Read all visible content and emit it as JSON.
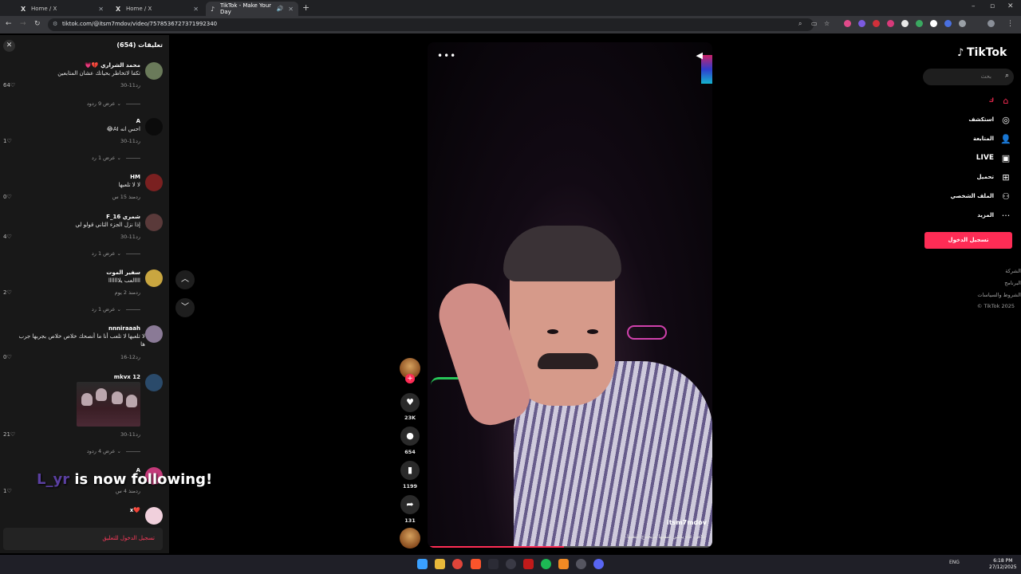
{
  "browser": {
    "tabs": [
      {
        "label": "Home / X",
        "favicon": "X"
      },
      {
        "label": "Home / X",
        "favicon": "X"
      },
      {
        "label": "TikTok - Make Your Day",
        "favicon": "♪"
      }
    ],
    "url": "tiktok.com/@itsm7mdov/video/7578536727371992340"
  },
  "comments_panel": {
    "title": "تعليقات (654)",
    "items": [
      {
        "name": "محمد الشراري 💔💗",
        "text": "تكفا لاتخاطر بحياتك عشان المتابعين",
        "date": "11-30",
        "reply": "رد",
        "likes": "64",
        "replies": "عرض 9 ردود",
        "avatar_color": "#6a7a5a"
      },
      {
        "name": "A",
        "text": "احس انه AI😂",
        "date": "11-30",
        "reply": "رد",
        "likes": "1",
        "replies": "عرض 1 رد",
        "avatar_color": "#0b0b0b"
      },
      {
        "name": "HM",
        "text": "لا لا تلعبها",
        "date": "منذ 15 س",
        "reply": "رد",
        "likes": "0",
        "replies": "",
        "avatar_color": "#7a2020"
      },
      {
        "name": "شمري F_16",
        "text": "إذا نزل الجزء الثاني قولو لي",
        "date": "11-30",
        "reply": "رد",
        "likes": "4",
        "replies": "عرض 1 رد",
        "avatar_color": "#5a3a3a"
      },
      {
        "name": "سفير الموت",
        "text": "اااالعب يلااااااا",
        "date": "منذ 2 يوم",
        "reply": "رد",
        "likes": "2",
        "replies": "عرض 1 رد",
        "avatar_color": "#c9a640"
      },
      {
        "name": "nnniraaah",
        "text": "لا تلعبها لا تلعب أنا ما أنصحك خلاص خلاص بجربها جرب",
        "text2": "ها",
        "date": "12-16",
        "reply": "رد",
        "likes": "0",
        "replies": "",
        "avatar_color": "#8a7a96"
      },
      {
        "name": "mkvx 12",
        "text": "",
        "date": "11-30",
        "reply": "رد",
        "likes": "21",
        "replies": "عرض 4 ردود",
        "avatar_color": "#2a4a6a"
      },
      {
        "name": "A",
        "text": "",
        "date": "منذ 4 س",
        "reply": "رد",
        "likes": "1",
        "replies": "",
        "avatar_color": "#c43a7a"
      },
      {
        "name": "❤️x",
        "text": "",
        "date": "",
        "reply": "",
        "likes": "",
        "replies": "",
        "avatar_color": "#f0d0dc"
      }
    ],
    "login_prompt": "تسجيل الدخول للتعليق"
  },
  "overlay": {
    "follower": "L_yr",
    "message": "is now following!"
  },
  "video": {
    "username": "itsm7mdov",
    "caption": "خلاص عاد يكفي شفتها مايحتاج التعيها..",
    "progress": 0.48
  },
  "actions": {
    "likes": "23K",
    "comments": "654",
    "saves": "1199",
    "shares": "131"
  },
  "sidebar": {
    "logo": "TikTok",
    "search_placeholder": "بحث",
    "nav": [
      {
        "label": "ك",
        "icon": "home-icon",
        "active": true
      },
      {
        "label": "استكشف",
        "icon": "compass-icon"
      },
      {
        "label": "المتابعة",
        "icon": "user-plus-icon"
      },
      {
        "label": "LIVE",
        "icon": "live-icon"
      },
      {
        "label": "تحميل",
        "icon": "upload-icon"
      },
      {
        "label": "الملف الشخصي",
        "icon": "profile-icon"
      },
      {
        "label": "المزيد",
        "icon": "more-icon"
      }
    ],
    "login_button": "تسجيل الدخول",
    "footer": [
      "الشركة",
      "البرنامج",
      "الشروط والسياسات",
      "© TikTok 2025"
    ]
  },
  "taskbar": {
    "lang": "ENG",
    "time": "6:18 PM",
    "date": "27/12/2025"
  },
  "colors": {
    "accent": "#fe2c55",
    "panel": "#181818",
    "chrome": "#35363a"
  }
}
